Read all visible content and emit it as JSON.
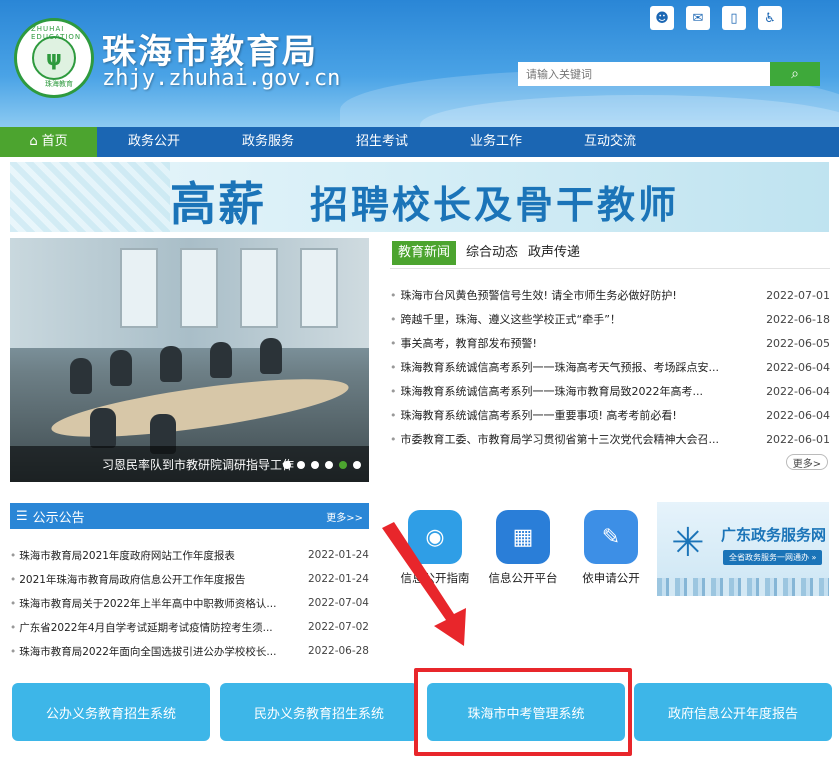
{
  "header": {
    "site_title": "珠海市教育局",
    "domain": "zhjy.zhuhai.gov.cn",
    "logo_ring_text": "ZHUHAI EDUCATION",
    "logo_center": "ψ",
    "logo_bottom": "珠海教育",
    "top_icons": [
      "robot-icon",
      "wechat-icon",
      "mobile-icon",
      "accessibility-icon"
    ],
    "search_placeholder": "请输入关键词",
    "search_button": "Q"
  },
  "nav": {
    "home": "首页",
    "items": [
      "政务公开",
      "政务服务",
      "招生考试",
      "业务工作",
      "互动交流"
    ]
  },
  "banner": {
    "big": "高薪",
    "text": "招聘校长及骨干教师"
  },
  "photo": {
    "caption": "习恩民率队到市教研院调研指导工作"
  },
  "news": {
    "tabs": [
      "教育新闻",
      "综合动态",
      "政声传递"
    ],
    "items": [
      {
        "title": "珠海市台风黄色预警信号生效! 请全市师生务必做好防护!",
        "date": "2022-07-01"
      },
      {
        "title": "跨越千里，珠海、遵义这些学校正式“牵手”！",
        "date": "2022-06-18"
      },
      {
        "title": "事关高考，教育部发布预警!",
        "date": "2022-06-05"
      },
      {
        "title": "珠海教育系统诚信高考系列一一珠海高考天气预报、考场踩点安...",
        "date": "2022-06-04"
      },
      {
        "title": "珠海教育系统诚信高考系列一一珠海市教育局致2022年高考...",
        "date": "2022-06-04"
      },
      {
        "title": "珠海教育系统诚信高考系列一一重要事项! 高考考前必看!",
        "date": "2022-06-04"
      },
      {
        "title": "市委教育工委、市教育局学习贯彻省第十三次党代会精神大会召...",
        "date": "2022-06-01"
      }
    ],
    "more": "更多>"
  },
  "notice": {
    "title": "公示公告",
    "more": "更多>>",
    "items": [
      {
        "title": "珠海市教育局2021年度政府网站工作年度报表",
        "date": "2022-01-24"
      },
      {
        "title": "2021年珠海市教育局政府信息公开工作年度报告",
        "date": "2022-01-24"
      },
      {
        "title": "珠海市教育局关于2022年上半年高中中职教师资格认...",
        "date": "2022-07-04"
      },
      {
        "title": "广东省2022年4月自学考试延期考试疫情防控考生须...",
        "date": "2022-07-02"
      },
      {
        "title": "珠海市教育局2022年面向全国选拔引进公办学校校长...",
        "date": "2022-06-28"
      }
    ]
  },
  "services": [
    {
      "label": "信息公开指南",
      "icon": "compass-icon",
      "color": "#2f9ee6"
    },
    {
      "label": "信息公开平台",
      "icon": "grid-icon",
      "color": "#2a7ed8"
    },
    {
      "label": "依申请公开",
      "icon": "document-edit-icon",
      "color": "#3d8fe6"
    }
  ],
  "gd": {
    "title": "广东政务服务网",
    "sub": "全省政务服务一网通办 »"
  },
  "buttons": [
    "公办义务教育招生系统",
    "民办义务教育招生系统",
    "珠海市中考管理系统",
    "政府信息公开年度报告"
  ],
  "colors": {
    "nav": "#1b66b3",
    "accent_green": "#4ca42f",
    "button": "#3db6e8",
    "highlight": "#e8262b"
  }
}
